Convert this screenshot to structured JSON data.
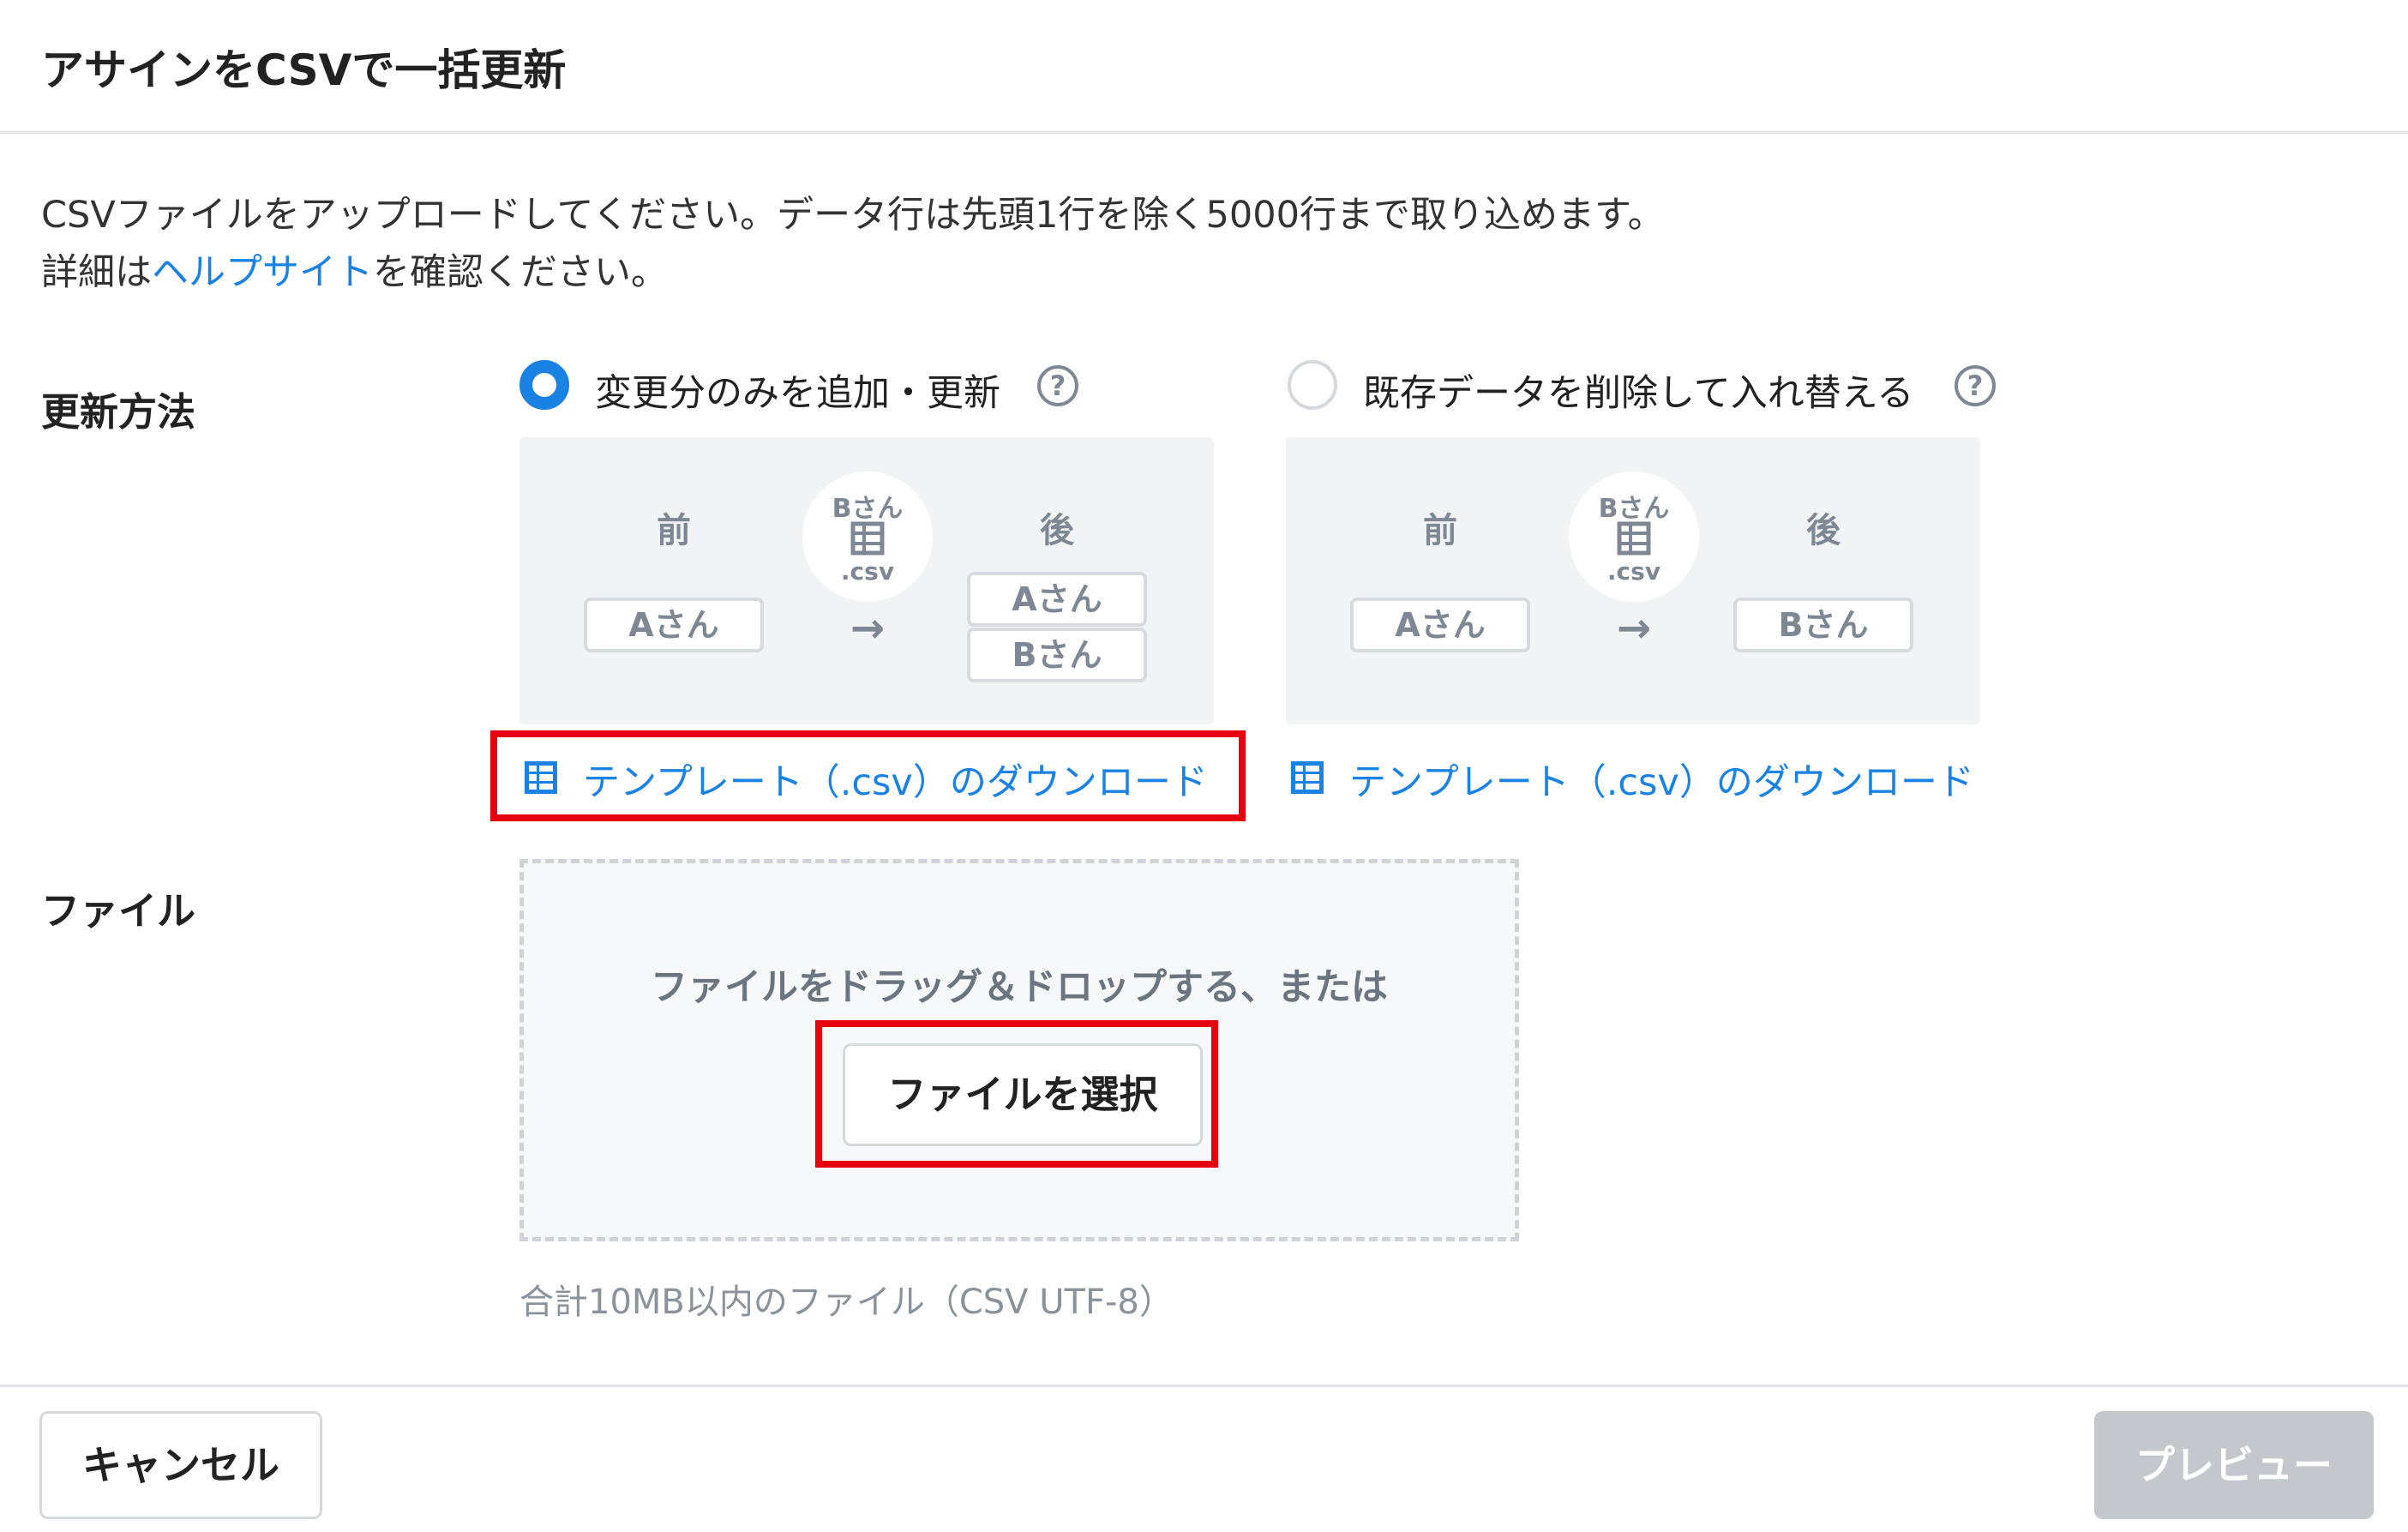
{
  "dialog": {
    "title": "アサインをCSVで一括更新"
  },
  "description": {
    "line1": "CSVファイルをアップロードしてください。データ行は先頭1行を除く5000行まで取り込めます。",
    "line2_prefix": "詳細は",
    "help_link": "ヘルプサイト",
    "line2_suffix": "を確認ください。"
  },
  "update_method": {
    "label": "更新方法",
    "options": [
      {
        "label": "変更分のみを追加・更新",
        "selected": true,
        "diagram": {
          "before_label": "前",
          "after_label": "後",
          "before_items": [
            "Aさん"
          ],
          "csv_name": "Bさん",
          "csv_ext": ".csv",
          "after_items": [
            "Aさん",
            "Bさん"
          ]
        },
        "template_link": "テンプレート（.csv）のダウンロード"
      },
      {
        "label": "既存データを削除して入れ替える",
        "selected": false,
        "diagram": {
          "before_label": "前",
          "after_label": "後",
          "before_items": [
            "Aさん"
          ],
          "csv_name": "Bさん",
          "csv_ext": ".csv",
          "after_items": [
            "Bさん"
          ]
        },
        "template_link": "テンプレート（.csv）のダウンロード"
      }
    ]
  },
  "file": {
    "label": "ファイル",
    "drop_text": "ファイルをドラッグ＆ドロップする、または",
    "choose_button": "ファイルを選択",
    "note": "合計10MB以内のファイル（CSV UTF-8）"
  },
  "footer": {
    "cancel_label": "キャンセル",
    "preview_label": "プレビュー",
    "preview_enabled": false
  },
  "colors": {
    "accent": "#1a82e2",
    "highlight": "#e6000f",
    "disabled_button": "#c4c7cb"
  },
  "icons": {
    "help": "question-circle-icon",
    "spreadsheet": "spreadsheet-icon",
    "arrow": "arrow-right-icon"
  }
}
